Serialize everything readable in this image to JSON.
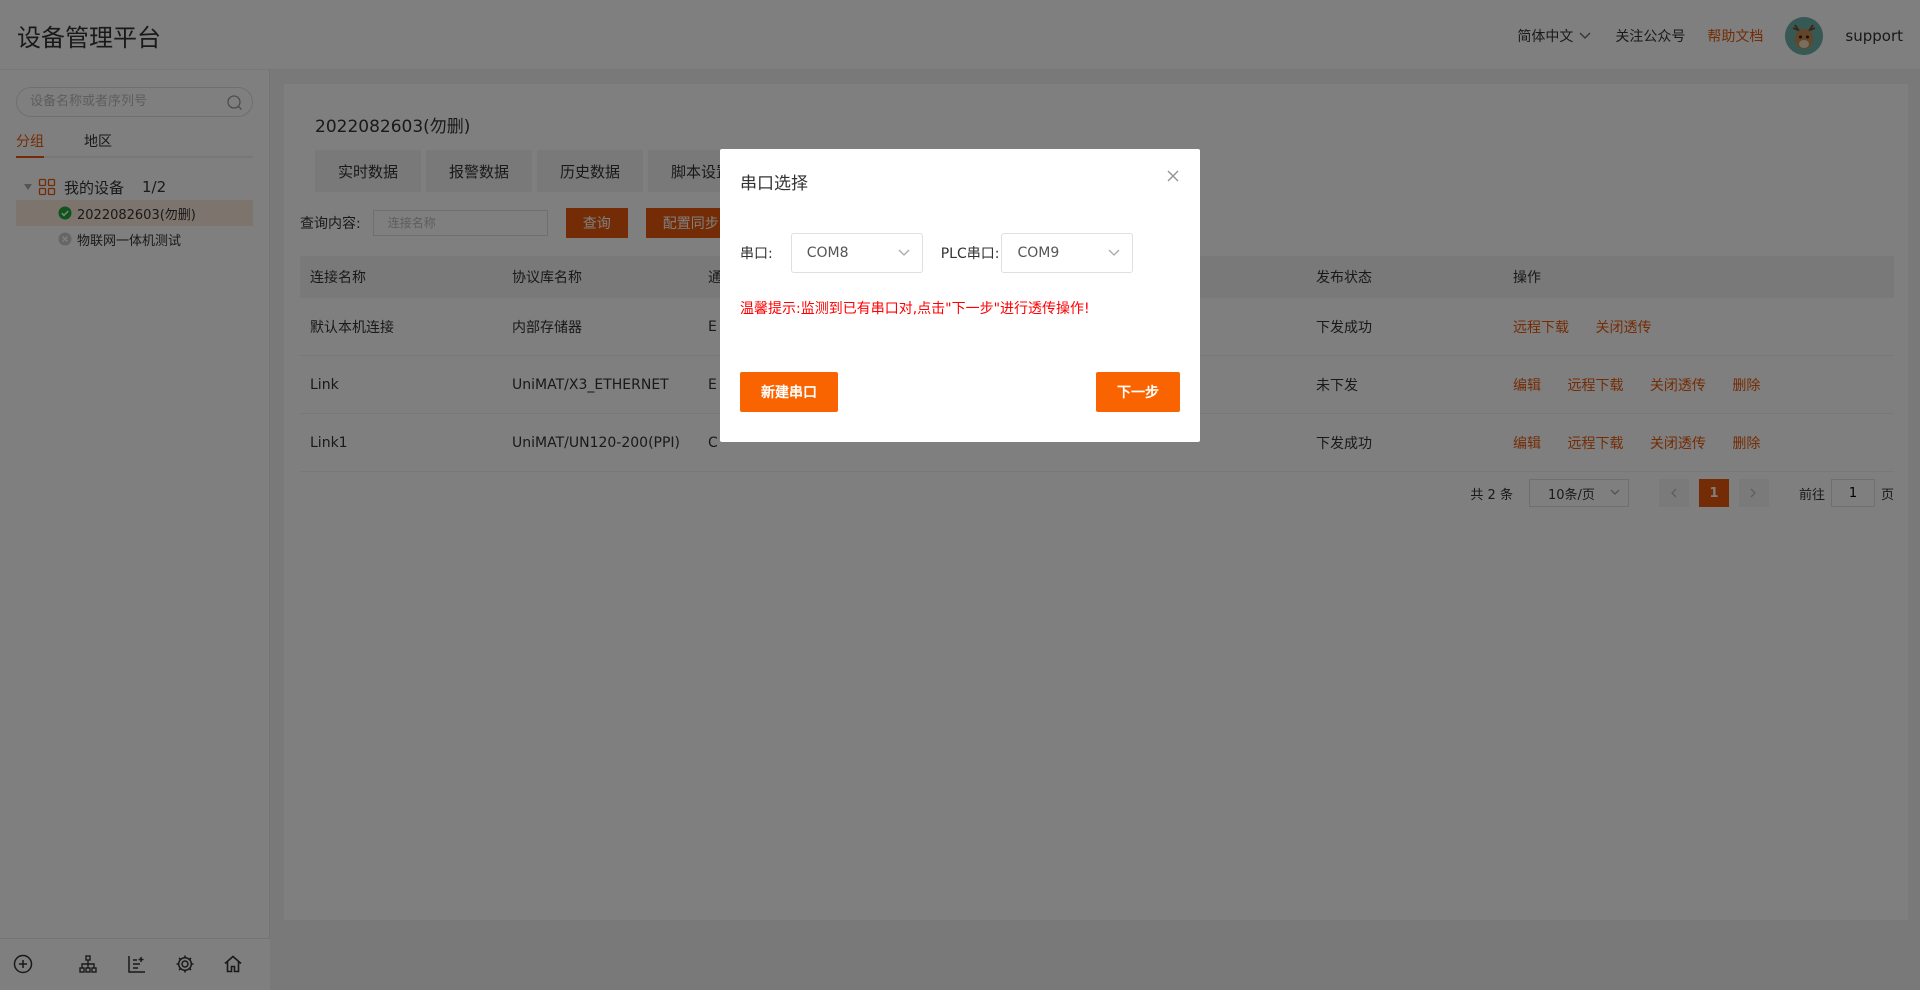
{
  "header": {
    "title": "设备管理平台",
    "language": "简体中文",
    "follow": "关注公众号",
    "help": "帮助文档",
    "username": "support"
  },
  "sidebar": {
    "search_placeholder": "设备名称或者序列号",
    "tabs": [
      "分组",
      "地区"
    ],
    "tree": {
      "root_label": "我的设备",
      "root_count": "1/2",
      "items": [
        {
          "label": "2022082603(勿删)",
          "status": "online"
        },
        {
          "label": "物联网一体机测试",
          "status": "offline"
        }
      ]
    }
  },
  "main": {
    "device_title": "2022082603(勿删)",
    "tabs": [
      "实时数据",
      "报警数据",
      "历史数据",
      "脚本设置",
      "",
      "",
      "",
      ""
    ],
    "query_label": "查询内容:",
    "query_placeholder": "连接名称",
    "query_button": "查询",
    "sync_button": "配置同步",
    "table": {
      "headers": [
        "连接名称",
        "协议库名称",
        "通",
        "发布状态",
        "操作"
      ],
      "rows": [
        {
          "name": "默认本机连接",
          "protocol": "内部存储器",
          "comm": "E",
          "status": "下发成功",
          "ops": [
            "远程下载",
            "关闭透传"
          ]
        },
        {
          "name": "Link",
          "protocol": "UniMAT/X3_ETHERNET",
          "comm": "E",
          "status": "未下发",
          "ops": [
            "编辑",
            "远程下载",
            "关闭透传",
            "删除"
          ]
        },
        {
          "name": "Link1",
          "protocol": "UniMAT/UN120-200(PPI)",
          "comm": "C",
          "status": "下发成功",
          "ops": [
            "编辑",
            "远程下载",
            "关闭透传",
            "删除"
          ]
        }
      ]
    },
    "pager": {
      "total": "共 2 条",
      "page_size": "10条/页",
      "current": "1",
      "goto_prefix": "前往",
      "goto_value": "1",
      "goto_suffix": "页"
    }
  },
  "dialog": {
    "title": "串口选择",
    "port_label": "串口:",
    "port_value": "COM8",
    "plc_label": "PLC串口:",
    "plc_value": "COM9",
    "tip": "温馨提示:监测到已有串口对,点击\"下一步\"进行透传操作!",
    "new_button": "新建串口",
    "next_button": "下一步"
  },
  "colors": {
    "accent": "#e8590c",
    "button": "#fa6400",
    "tip": "#ff0000"
  }
}
